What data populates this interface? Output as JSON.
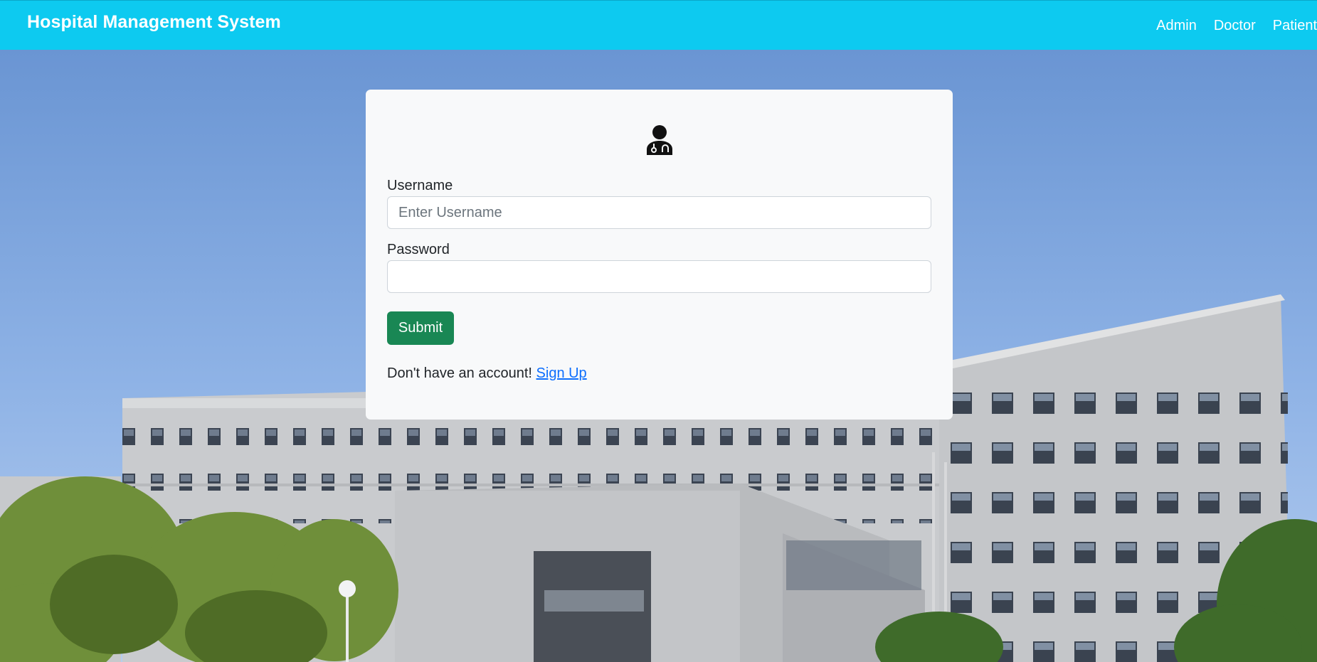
{
  "navbar": {
    "brand": "Hospital Management System",
    "links": [
      "Admin",
      "Doctor",
      "Patient"
    ],
    "background_color": "#0dcaf0"
  },
  "login_form": {
    "icon": "doctor-icon",
    "username_label": "Username",
    "username_placeholder": "Enter Username",
    "username_value": "",
    "password_label": "Password",
    "password_value": "",
    "submit_label": "Submit",
    "signup_prompt": "Don't have an account!",
    "signup_link": "Sign Up",
    "submit_color": "#198754",
    "link_color": "#0d6efd"
  }
}
